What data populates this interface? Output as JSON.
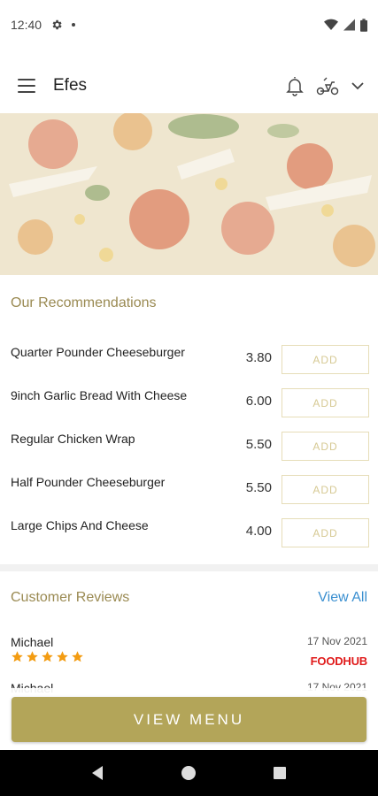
{
  "status_bar": {
    "time": "12:40",
    "icons": [
      "gear-icon",
      "dot-icon",
      "wifi-icon",
      "signal-icon",
      "battery-icon"
    ]
  },
  "app_bar": {
    "title": "Efes",
    "icons": [
      "menu-icon",
      "bell-icon",
      "scooter-icon",
      "chevron-down-icon"
    ]
  },
  "hero": {
    "image": "pizza-photo"
  },
  "recommendations": {
    "title": "Our Recommendations",
    "items": [
      {
        "name": "Quarter Pounder Cheeseburger",
        "price": "3.80",
        "button": "ADD"
      },
      {
        "name": "9inch Garlic Bread With Cheese",
        "price": "6.00",
        "button": "ADD"
      },
      {
        "name": "Regular Chicken Wrap",
        "price": "5.50",
        "button": "ADD"
      },
      {
        "name": "Half Pounder Cheeseburger",
        "price": "5.50",
        "button": "ADD"
      },
      {
        "name": "Large Chips And Cheese",
        "price": "4.00",
        "button": "ADD"
      }
    ]
  },
  "reviews": {
    "title": "Customer Reviews",
    "view_all": "View All",
    "items": [
      {
        "name": "Michael",
        "date": "17 Nov 2021",
        "rating": 5,
        "source": "FOODHUB"
      },
      {
        "name": "Michael",
        "date": "17 Nov 2021"
      }
    ]
  },
  "view_menu": {
    "label": "VIEW MENU"
  },
  "colors": {
    "accent": "#b3a559",
    "section_title": "#9a8a52",
    "link": "#3a8fd0",
    "star": "#f39c12",
    "foodhub_red": "#e01b1b"
  },
  "nav_bar": {
    "icons": [
      "back-icon",
      "home-icon",
      "recents-icon"
    ]
  }
}
